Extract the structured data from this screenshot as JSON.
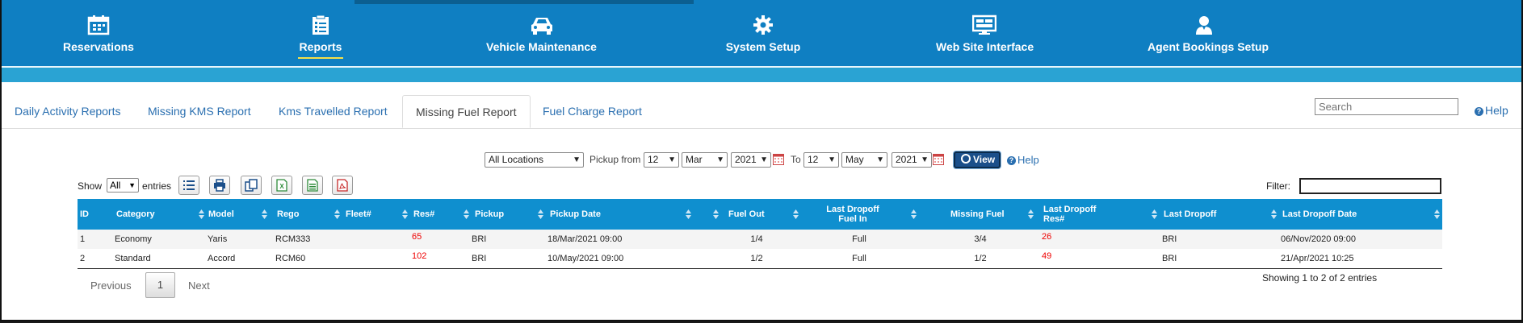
{
  "nav": {
    "items": [
      {
        "label": "Reservations",
        "icon": "calendar-icon"
      },
      {
        "label": "Reports",
        "icon": "clipboard-icon",
        "active": true
      },
      {
        "label": "Vehicle Maintenance",
        "icon": "car-icon"
      },
      {
        "label": "System Setup",
        "icon": "gear-icon"
      },
      {
        "label": "Web Site Interface",
        "icon": "monitor-icon"
      },
      {
        "label": "Agent Bookings Setup",
        "icon": "user-icon"
      }
    ]
  },
  "tabs": [
    {
      "label": "Daily Activity Reports"
    },
    {
      "label": "Missing KMS Report"
    },
    {
      "label": "Kms Travelled Report"
    },
    {
      "label": "Missing Fuel Report",
      "active": true
    },
    {
      "label": "Fuel Charge Report"
    }
  ],
  "search": {
    "placeholder": "Search"
  },
  "help": {
    "label": "Help"
  },
  "filters": {
    "location": "All Locations",
    "pickup_from_label": "Pickup from",
    "from_day": "12",
    "from_month": "Mar",
    "from_year": "2021",
    "to_label": "To",
    "to_day": "12",
    "to_month": "May",
    "to_year": "2021",
    "view_label": "View",
    "help_label": "Help"
  },
  "controls": {
    "show_label": "Show",
    "entries_value": "All",
    "entries_label": "entries",
    "filter_label": "Filter:",
    "export_icons": [
      "list-icon",
      "print-icon",
      "copy-icon",
      "excel-icon",
      "csv-icon",
      "pdf-icon"
    ]
  },
  "table": {
    "headers": [
      "ID",
      "Category",
      "Model",
      "Rego",
      "Fleet#",
      "Res#",
      "Pickup",
      "Pickup Date",
      "Fuel Out",
      "Last Dropoff Fuel In",
      "Missing Fuel",
      "Last Dropoff Res#",
      "Last Dropoff",
      "Last Dropoff Date"
    ],
    "header_line1": {
      "fuel_in": "Last Dropoff",
      "res": "Last Dropoff"
    },
    "header_line2": {
      "fuel_in": "Fuel In",
      "res": "Res#"
    },
    "rows": [
      {
        "id": "1",
        "category": "Economy",
        "model": "Yaris",
        "rego": "RCM333",
        "fleet": "",
        "res": "65",
        "pickup": "BRI",
        "pickup_date": "18/Mar/2021 09:00",
        "fuel_out": "1/4",
        "fuel_in": "Full",
        "missing_fuel": "3/4",
        "last_res": "26",
        "last_dropoff": "BRI",
        "last_dropoff_date": "06/Nov/2020 09:00"
      },
      {
        "id": "2",
        "category": "Standard",
        "model": "Accord",
        "rego": "RCM60",
        "fleet": "",
        "res": "102",
        "pickup": "BRI",
        "pickup_date": "10/May/2021 09:00",
        "fuel_out": "1/2",
        "fuel_in": "Full",
        "missing_fuel": "1/2",
        "last_res": "49",
        "last_dropoff": "BRI",
        "last_dropoff_date": "21/Apr/2021 10:25"
      }
    ]
  },
  "pagination": {
    "previous": "Previous",
    "page": "1",
    "next": "Next",
    "summary": "Showing 1 to 2 of 2 entries"
  },
  "colors": {
    "nav_bg": "#0f7fc2",
    "table_header": "#0f8fcf",
    "link": "#2a6fb0",
    "accent_underline": "#f5e04a",
    "res_red": "#ee0000"
  }
}
